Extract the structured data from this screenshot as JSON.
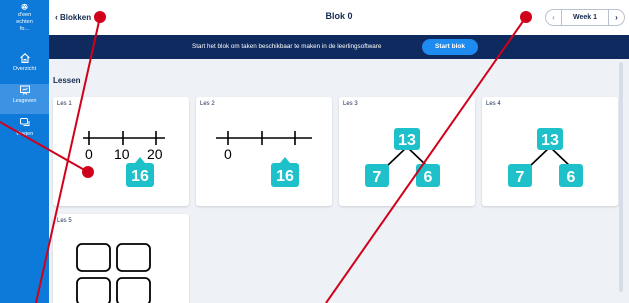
{
  "sidebar": {
    "top_item": {
      "line1": "d'een",
      "line2": "echten",
      "line3": "fo..."
    },
    "items": [
      {
        "label": "Overzicht",
        "icon": "home-icon",
        "active": false
      },
      {
        "label": "Lesgeven",
        "icon": "presentation-icon",
        "active": true
      },
      {
        "label": "Vragen",
        "icon": "chat-icon",
        "active": false
      }
    ]
  },
  "header": {
    "back_label": "Blokken",
    "title": "Blok 0",
    "week_label": "Week 1"
  },
  "banner": {
    "text": "Start het blok om taken beschikbaar te maken in de leerlingsoftware",
    "button_label": "Start blok"
  },
  "content": {
    "section_title": "Lessen",
    "lessons": [
      {
        "label": "Les 1",
        "number_line_labels": [
          "0",
          "10",
          "20"
        ],
        "badge": "16"
      },
      {
        "label": "Les 2",
        "number_line_labels": [
          "0"
        ],
        "badge": "16"
      },
      {
        "label": "Les 3",
        "tree_top": "13",
        "tree_left": "7",
        "tree_right": "6"
      },
      {
        "label": "Les 4",
        "tree_top": "13",
        "tree_left": "7",
        "tree_right": "6"
      },
      {
        "label": "Les 5"
      }
    ]
  },
  "colors": {
    "sidebar": "#0d7ad9",
    "banner": "#0f2a5e",
    "button": "#1d8bf0",
    "teal": "#1ec0c9",
    "annotation": "#d0021b"
  }
}
